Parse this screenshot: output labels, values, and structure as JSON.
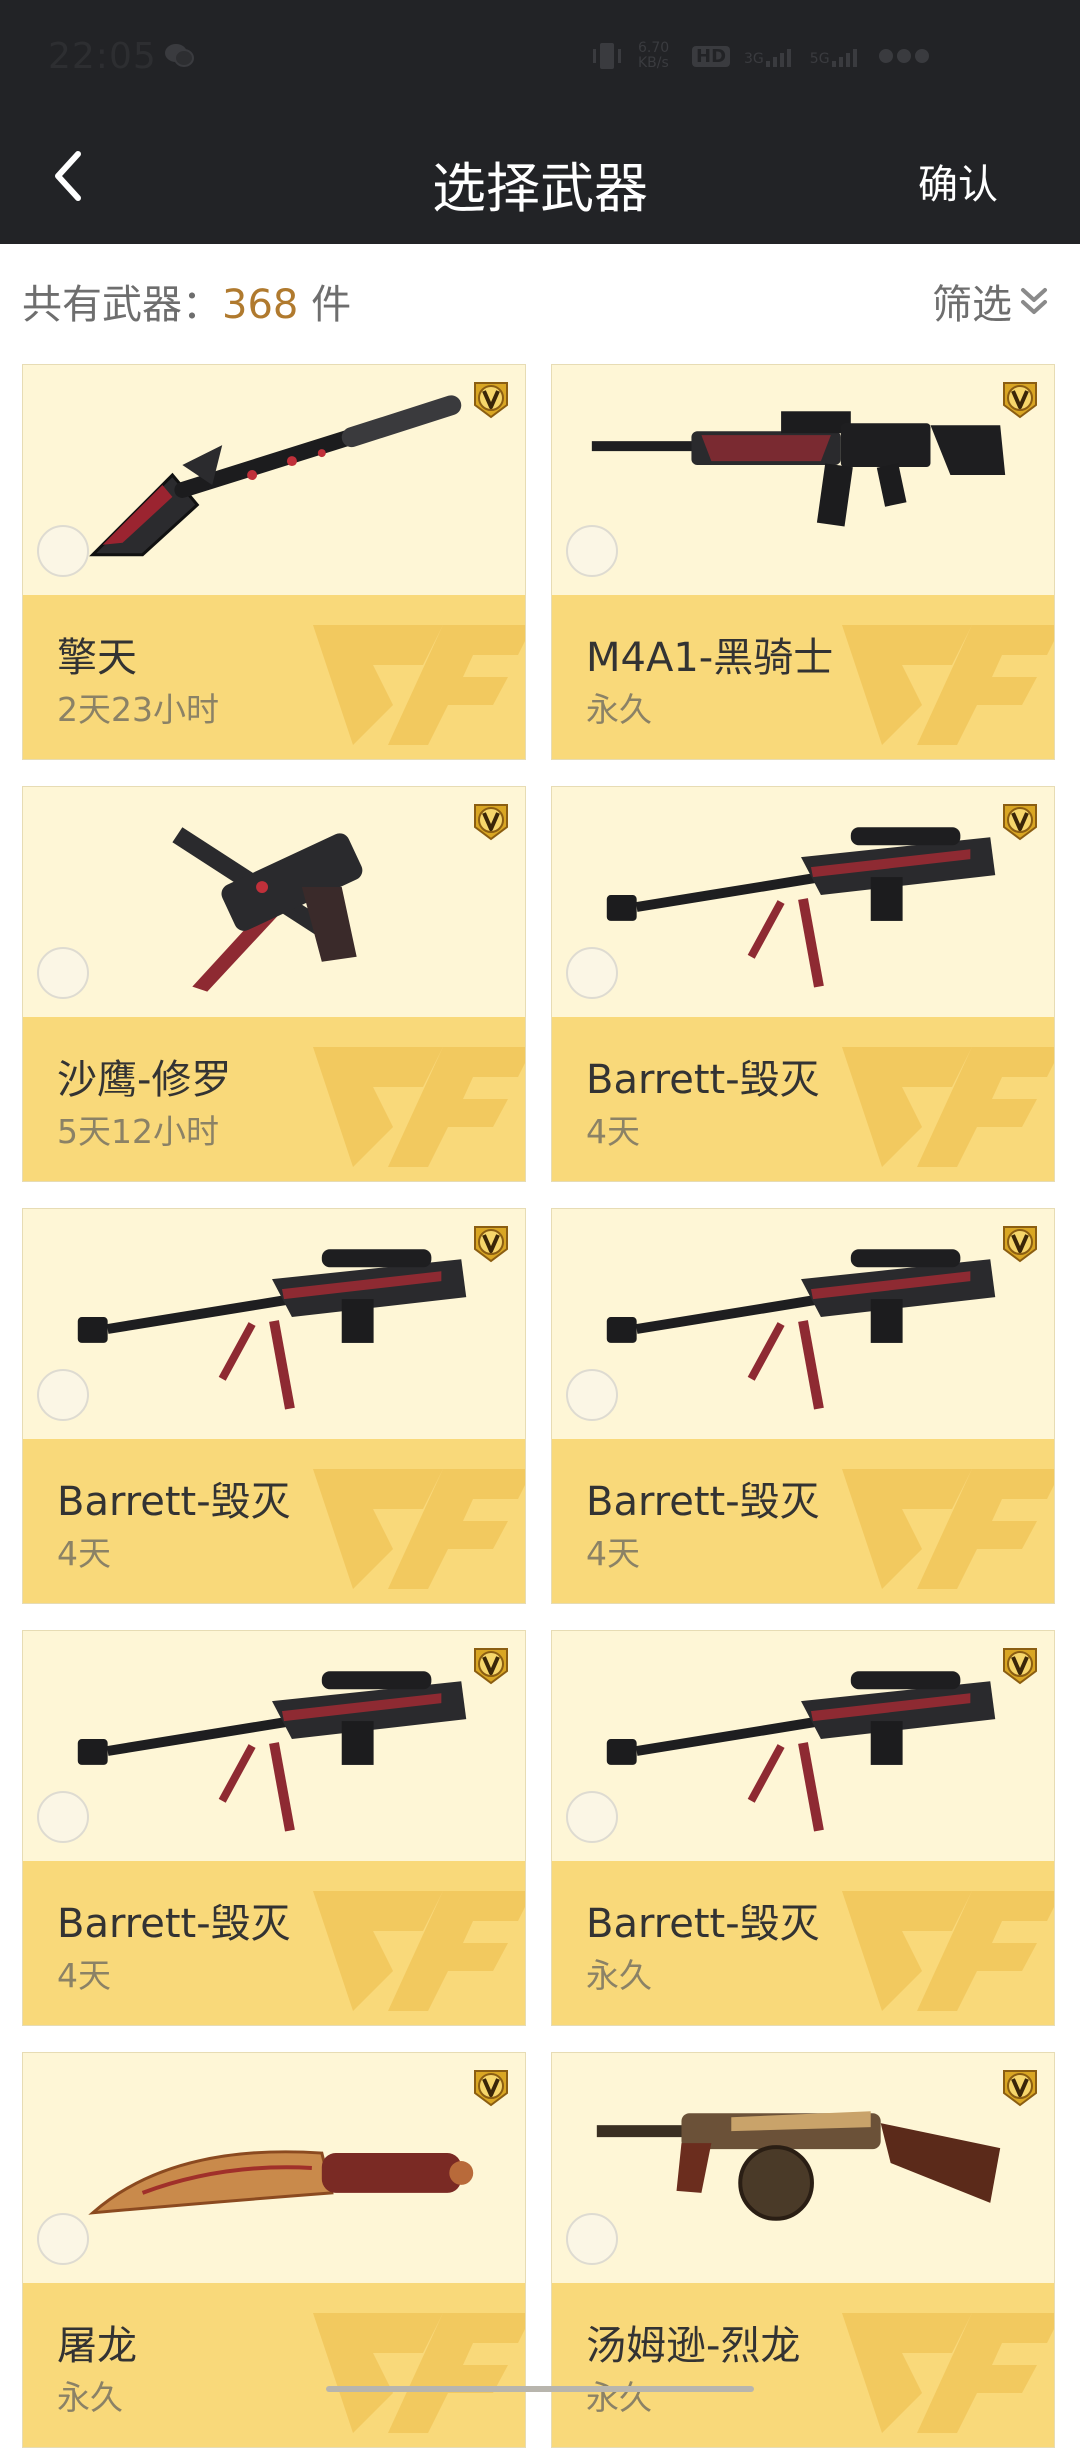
{
  "status_bar": {
    "time": "22:05",
    "net_speed": "6.70 KB/s",
    "icons": [
      "wechat-icon",
      "vibrate-icon",
      "hd-icon",
      "signal-3g-icon",
      "signal-5g-icon",
      "battery-icon"
    ],
    "sig1": "3G",
    "sig2": "5G",
    "hd": "HD"
  },
  "nav": {
    "title": "选择武器",
    "confirm_label": "确认",
    "back_icon": "chevron-left-icon"
  },
  "summary": {
    "prefix": "共有武器：",
    "count": "368",
    "unit": "件"
  },
  "filter": {
    "label": "筛选"
  },
  "colors": {
    "header_bg": "#222326",
    "card_bg": "#fef6d6",
    "card_info_bg": "#f9d97a",
    "count_color": "#b07a2e",
    "cf_logo": "#f1c65a"
  },
  "weapons": [
    {
      "name": "擎天",
      "duration": "2天23小时",
      "type": "shovel"
    },
    {
      "name": "M4A1-黑骑士",
      "duration": "永久",
      "type": "rifle"
    },
    {
      "name": "沙鹰-修罗",
      "duration": "5天12小时",
      "type": "pistol"
    },
    {
      "name": "Barrett-毁灭",
      "duration": "4天",
      "type": "sniper"
    },
    {
      "name": "Barrett-毁灭",
      "duration": "4天",
      "type": "sniper"
    },
    {
      "name": "Barrett-毁灭",
      "duration": "4天",
      "type": "sniper"
    },
    {
      "name": "Barrett-毁灭",
      "duration": "4天",
      "type": "sniper"
    },
    {
      "name": "Barrett-毁灭",
      "duration": "永久",
      "type": "sniper"
    },
    {
      "name": "屠龙",
      "duration": "永久",
      "type": "knife"
    },
    {
      "name": "汤姆逊-烈龙",
      "duration": "永久",
      "type": "smg"
    }
  ]
}
